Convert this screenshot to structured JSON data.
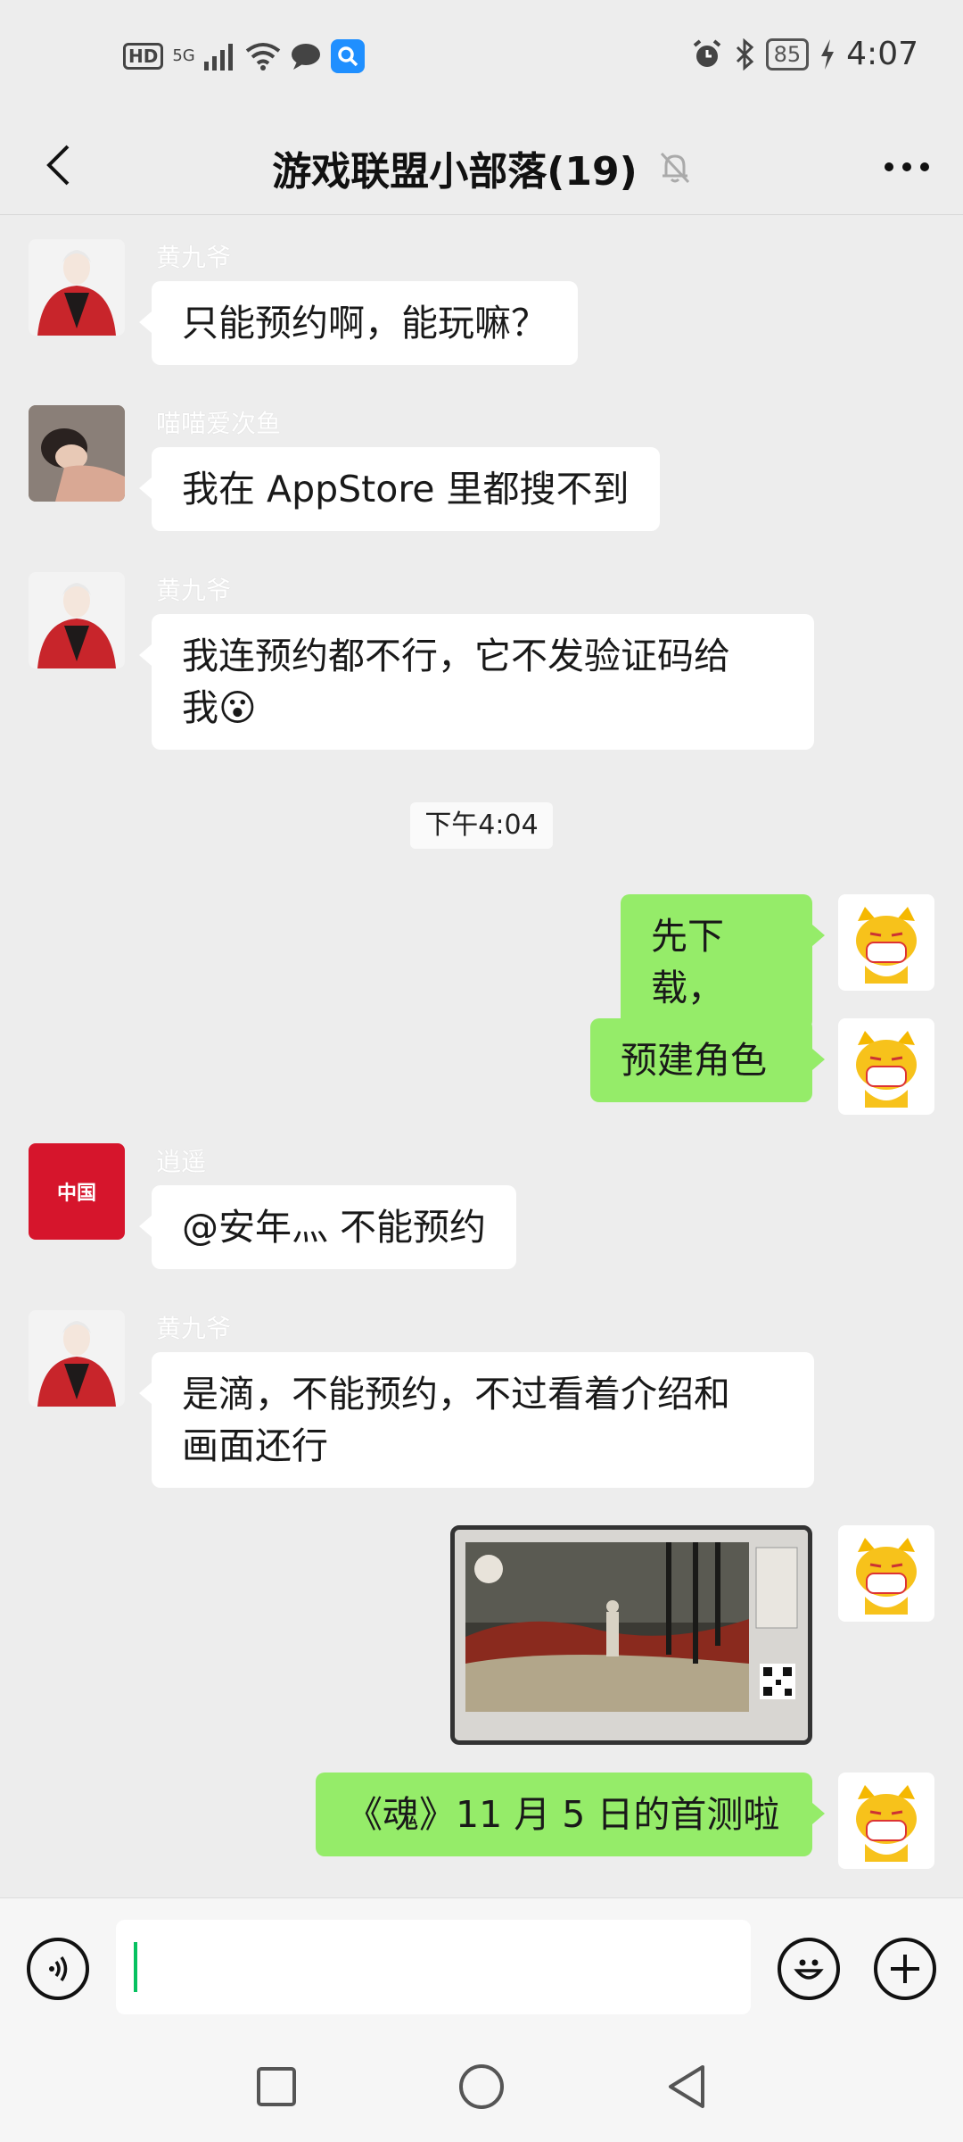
{
  "status_bar": {
    "hd": "HD",
    "network": "5G",
    "battery": "85",
    "time": "4:07"
  },
  "header": {
    "title": "游戏联盟小部落(19)"
  },
  "messages": [
    {
      "sender": "黄九爷",
      "text": "只能预约啊，能玩嘛？",
      "side": "in"
    },
    {
      "sender": "喵喵爱次鱼",
      "text": "我在 AppStore 里都搜不到",
      "side": "in"
    },
    {
      "sender": "黄九爷",
      "text_line1": "我连预约都不行，它不发验证码给",
      "text_line2": "我😮",
      "side": "in"
    },
    {
      "timestamp": "下午4:04"
    },
    {
      "text": "先下载，",
      "side": "out"
    },
    {
      "text": "预建角色",
      "side": "out"
    },
    {
      "sender": "逍遥",
      "avatar_text": "中国",
      "text": "@安年灬  不能预约",
      "side": "in"
    },
    {
      "sender": "黄九爷",
      "text_line1": "是滴，不能预约，不过看着介绍和",
      "text_line2": "画面还行",
      "side": "in"
    },
    {
      "image": "game-screenshot",
      "side": "out"
    },
    {
      "text": "《魂》11 月 5 日的首测啦",
      "side": "out"
    }
  ],
  "colors": {
    "background": "#ededed",
    "bubble_in": "#ffffff",
    "bubble_out": "#95ec69",
    "accent": "#07c160"
  }
}
